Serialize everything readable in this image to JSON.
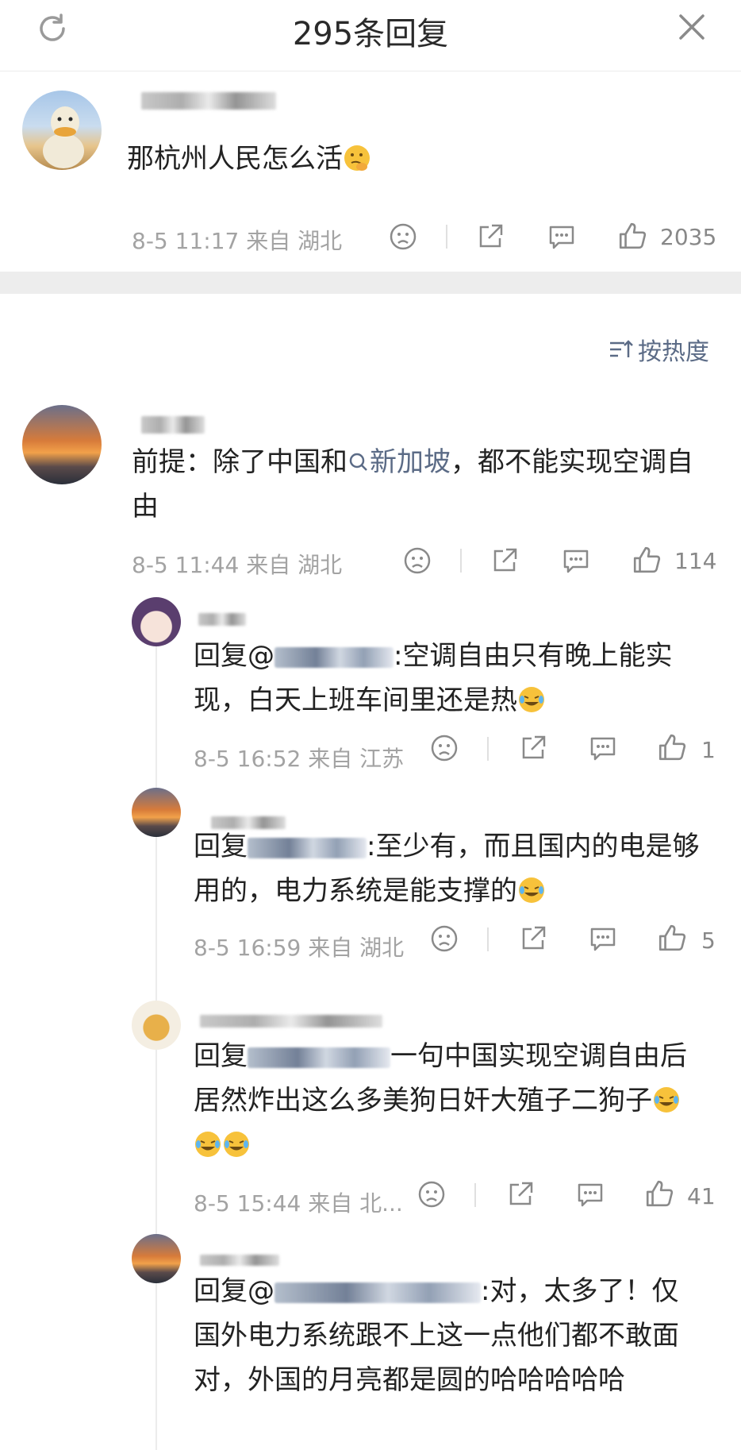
{
  "header": {
    "title": "295条回复"
  },
  "root_comment": {
    "text": "那杭州人民怎么活",
    "meta": "8-5 11:17 来自 湖北",
    "likes": "2035"
  },
  "sort": {
    "label": "按热度"
  },
  "comments": [
    {
      "text_a": "前提：除了中国和",
      "link": "新加坡",
      "text_b": "，都不能实现空调自由",
      "meta": "8-5 11:44 来自 湖北",
      "likes": "114"
    }
  ],
  "replies": [
    {
      "prefix": "回复@",
      "text": ":空调自由只有晚上能实现，白天上班车间里还是热",
      "meta": "8-5 16:52 来自 江苏",
      "likes": "1"
    },
    {
      "prefix": "回复",
      "text": ":至少有，而且国内的电是够用的，电力系统是能支撑的",
      "meta": "8-5 16:59 来自 湖北",
      "likes": "5"
    },
    {
      "prefix": "回复",
      "text": "一句中国实现空调自由后居然炸出这么多美狗日奸大殖子二狗子",
      "meta": "8-5 15:44 来自 北...",
      "likes": "41"
    },
    {
      "prefix": "回复@",
      "text": ":对，太多了！仅国外电力系统跟不上这一点他们都不敢面对，外国的月亮都是圆的哈哈哈哈哈"
    }
  ],
  "colors": {
    "link": "#5b6b86",
    "meta": "#a3a3a3",
    "divider": "#ededed"
  },
  "icons": [
    "refresh-icon",
    "close-icon",
    "sad-face-icon",
    "share-icon",
    "comment-icon",
    "like-icon",
    "sort-icon",
    "search-icon",
    "laugh-cry-emoji",
    "thinking-emoji"
  ]
}
